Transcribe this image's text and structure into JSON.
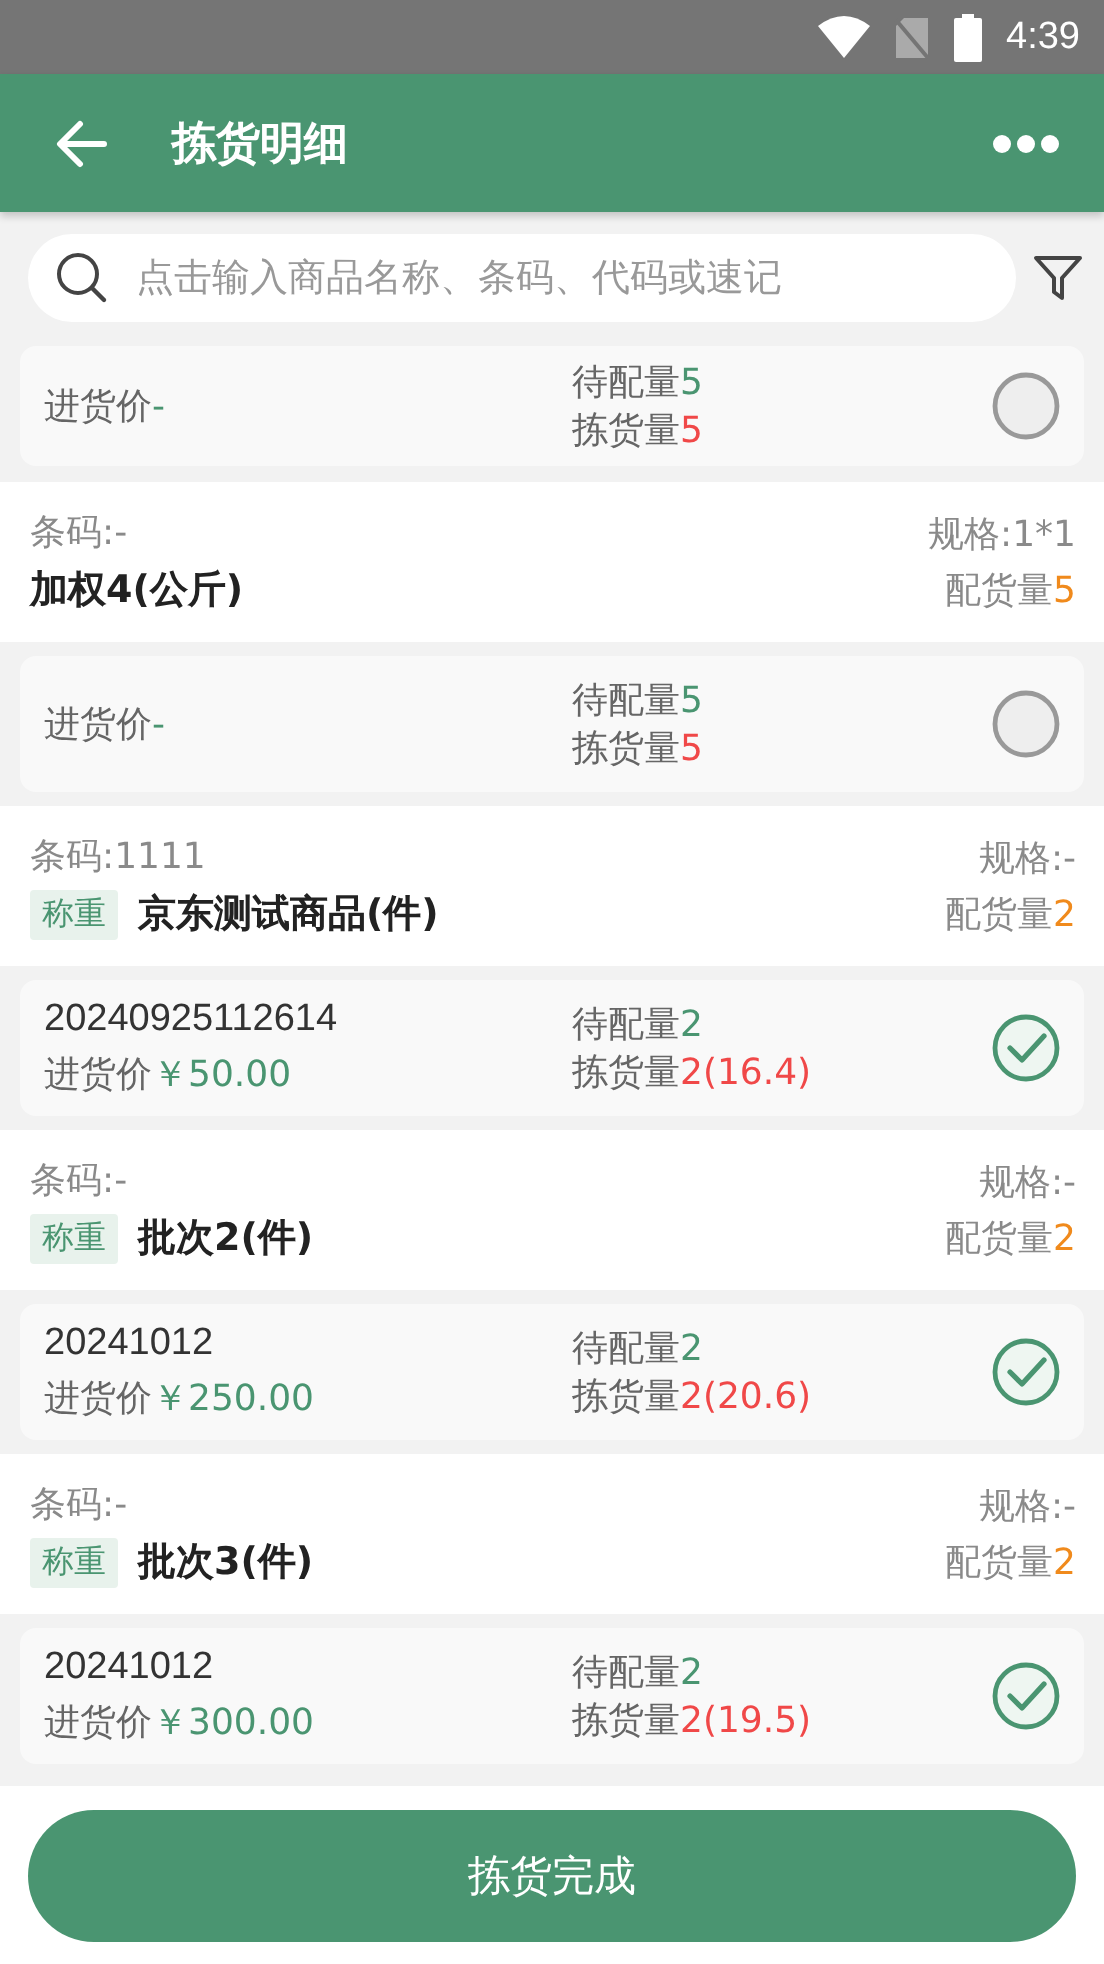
{
  "status_bar": {
    "time": "4:39"
  },
  "header": {
    "title": "拣货明细"
  },
  "search": {
    "placeholder": "点击输入商品名称、条码、代码或速记"
  },
  "rows": [
    {
      "kind": "batch",
      "price_label": "进货价",
      "price": "-",
      "pending_label": "待配量",
      "pending": "5",
      "picked_label": "拣货量",
      "picked": "5",
      "done": false
    },
    {
      "kind": "product",
      "barcode": "条码:-",
      "name": "加权4(公斤)",
      "spec": "规格:1*1",
      "alloc_label": "配货量",
      "alloc": "5"
    },
    {
      "kind": "batch",
      "price_label": "进货价",
      "price": "-",
      "pending_label": "待配量",
      "pending": "5",
      "picked_label": "拣货量",
      "picked": "5",
      "done": false
    },
    {
      "kind": "product",
      "barcode": "条码:1111",
      "tag": "称重",
      "name": "京东测试商品(件)",
      "spec": "规格:-",
      "alloc_label": "配货量",
      "alloc": "2"
    },
    {
      "kind": "batch",
      "batch_no": "20240925112614",
      "price_label": "进货价",
      "price": "￥50.00",
      "pending_label": "待配量",
      "pending": "2",
      "picked_label": "拣货量",
      "picked": "2",
      "picked_weight": "(16.4)",
      "done": true
    },
    {
      "kind": "product",
      "barcode": "条码:-",
      "tag": "称重",
      "name": "批次2(件)",
      "spec": "规格:-",
      "alloc_label": "配货量",
      "alloc": "2"
    },
    {
      "kind": "batch",
      "batch_no": "20241012",
      "price_label": "进货价",
      "price": "￥250.00",
      "pending_label": "待配量",
      "pending": "2",
      "picked_label": "拣货量",
      "picked": "2",
      "picked_weight": "(20.6)",
      "done": true
    },
    {
      "kind": "product",
      "barcode": "条码:-",
      "tag": "称重",
      "name": "批次3(件)",
      "spec": "规格:-",
      "alloc_label": "配货量",
      "alloc": "2"
    },
    {
      "kind": "batch",
      "batch_no": "20241012",
      "price_label": "进货价",
      "price": "￥300.00",
      "pending_label": "待配量",
      "pending": "2",
      "picked_label": "拣货量",
      "picked": "2",
      "picked_weight": "(19.5)",
      "done": true
    }
  ],
  "footer": {
    "button": "拣货完成"
  }
}
